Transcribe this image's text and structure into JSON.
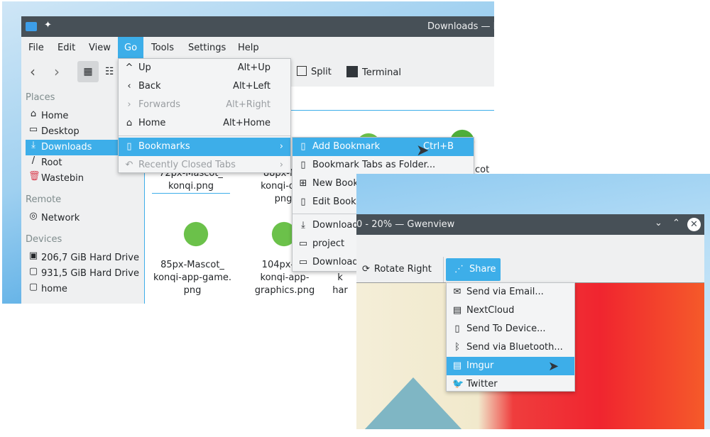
{
  "dolphin": {
    "title": "Downloads — D",
    "menubar": [
      "File",
      "Edit",
      "View",
      "Go",
      "Tools",
      "Settings",
      "Help"
    ],
    "toolbar": {
      "split": "Split",
      "terminal": "Terminal"
    },
    "sidebar": {
      "places_header": "Places",
      "places": [
        {
          "label": "Home",
          "icon": "home-icon"
        },
        {
          "label": "Desktop",
          "icon": "desktop-icon"
        },
        {
          "label": "Downloads",
          "icon": "download-icon"
        },
        {
          "label": "Root",
          "icon": "root-icon"
        },
        {
          "label": "Wastebin",
          "icon": "trash-icon"
        }
      ],
      "remote_header": "Remote",
      "remote": [
        {
          "label": "Network",
          "icon": "network-icon"
        }
      ],
      "devices_header": "Devices",
      "devices": [
        {
          "label": "206,7 GiB Hard Drive"
        },
        {
          "label": "931,5 GiB Hard Drive"
        },
        {
          "label": "home"
        }
      ]
    },
    "files": [
      {
        "l1": "72px-Mascot_",
        "l2": "konqi.png"
      },
      {
        "l1": "88px-Ma",
        "l2": "konqi-dev",
        "l3": "png"
      },
      {
        "l1": "cot"
      },
      {
        "l1": "85px-Mascot_",
        "l2": "konqi-app-game.",
        "l3": "png"
      },
      {
        "l1": "104px-Ma",
        "l2": "konqi-app-",
        "l3": "graphics.png"
      },
      {
        "l1": "k",
        "l2": "har"
      }
    ],
    "go_menu": [
      {
        "label": "Up",
        "shortcut": "Alt+Up",
        "icon": "chevron-up-icon"
      },
      {
        "label": "Back",
        "shortcut": "Alt+Left",
        "icon": "chevron-left-icon"
      },
      {
        "label": "Forwards",
        "shortcut": "Alt+Right",
        "icon": "chevron-right-icon",
        "disabled": true
      },
      {
        "label": "Home",
        "shortcut": "Alt+Home",
        "icon": "home-icon"
      },
      {
        "label": "Bookmarks",
        "icon": "bookmark-icon",
        "submenu": true,
        "highlighted": true
      },
      {
        "label": "Recently Closed Tabs",
        "icon": "undo-icon",
        "submenu": true,
        "disabled": true
      }
    ],
    "bookmarks_menu": [
      {
        "label": "Add Bookmark",
        "shortcut": "Ctrl+B",
        "highlighted": true
      },
      {
        "label": "Bookmark Tabs as Folder..."
      },
      {
        "label": "New Book"
      },
      {
        "label": "Edit Bookr"
      },
      {
        "label": "Download"
      },
      {
        "label": "project"
      },
      {
        "label": "Download"
      }
    ]
  },
  "gwenview": {
    "title": "0 - 20% — Gwenview",
    "toolbar": {
      "rotate_right": "Rotate Right",
      "share": "Share"
    },
    "share_menu": [
      {
        "label": "Send via Email...",
        "icon": "email-icon"
      },
      {
        "label": "NextCloud",
        "icon": "document-icon"
      },
      {
        "label": "Send To Device...",
        "icon": "phone-icon"
      },
      {
        "label": "Send via Bluetooth...",
        "icon": "bluetooth-icon"
      },
      {
        "label": "Imgur",
        "icon": "document-icon",
        "highlighted": true
      },
      {
        "label": "Twitter",
        "icon": "twitter-icon"
      }
    ]
  },
  "colors": {
    "accent": "#3daee9",
    "titlebar": "#475057",
    "window_bg": "#eff0f1"
  }
}
